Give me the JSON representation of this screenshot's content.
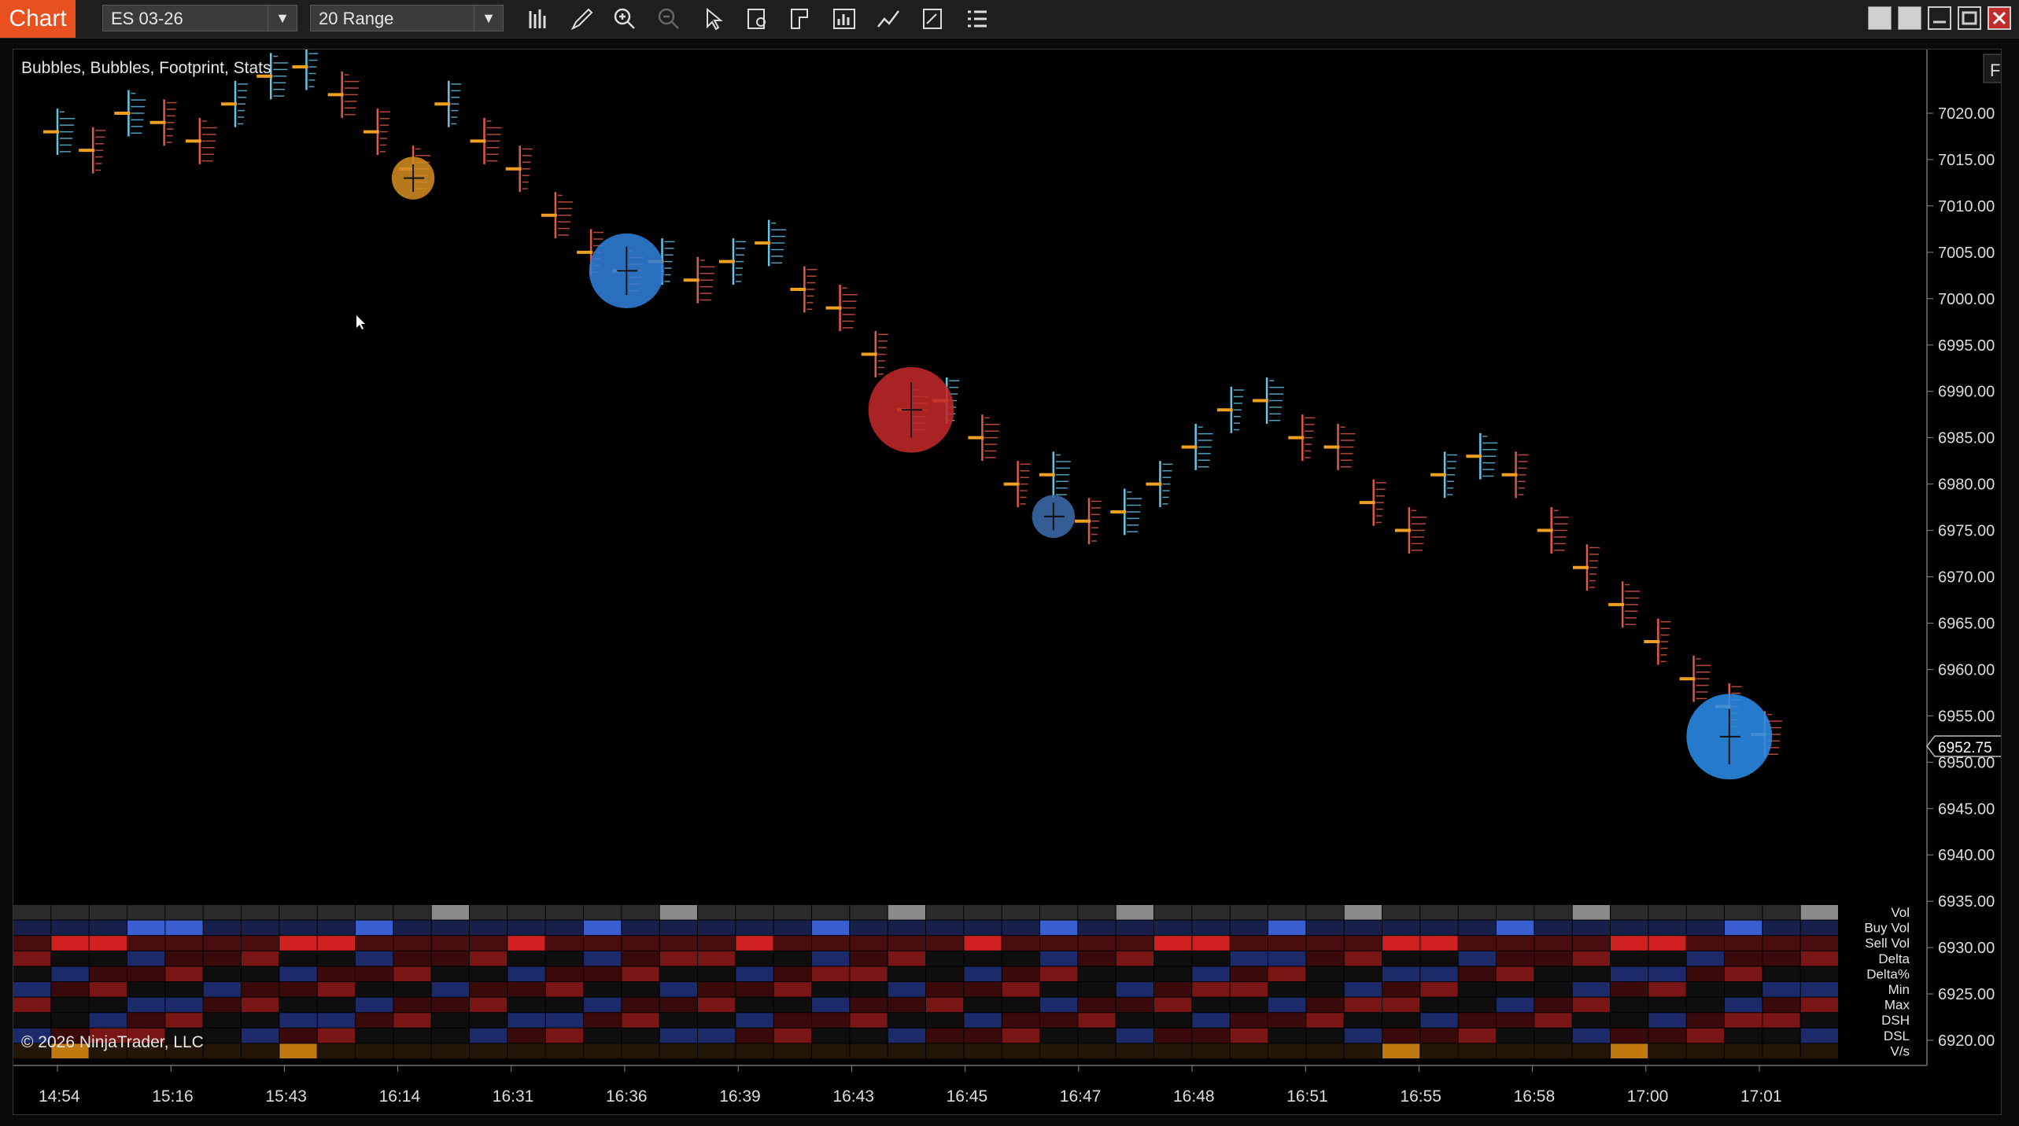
{
  "app": {
    "tab_label": "Chart"
  },
  "toolbar": {
    "instrument": "ES 03-26",
    "bar_type": "20 Range",
    "icons": [
      "bar-type-icon",
      "draw-pencil-icon",
      "zoom-in-icon",
      "zoom-out-icon",
      "pointer-icon",
      "data-box-icon",
      "templates-icon",
      "indicators-icon",
      "strategies-icon",
      "properties-icon",
      "list-icon"
    ]
  },
  "chart": {
    "indicator_label": "Bubbles, Bubbles, Footprint, Stats",
    "f_button_label": "F",
    "copyright": "© 2026 NinjaTrader, LLC",
    "last_price": "6952.75",
    "price_axis_labels": [
      "7020.00",
      "7015.00",
      "7010.00",
      "7005.00",
      "7000.00",
      "6995.00",
      "6990.00",
      "6985.00",
      "6980.00",
      "6975.00",
      "6970.00",
      "6965.00",
      "6960.00",
      "6955.00",
      "6950.00",
      "6945.00",
      "6940.00",
      "6935.00",
      "6930.00",
      "6925.00",
      "6920.00"
    ],
    "time_axis_labels": [
      "14:54",
      "15:16",
      "15:43",
      "16:14",
      "16:31",
      "16:36",
      "16:39",
      "16:43",
      "16:45",
      "16:47",
      "16:48",
      "16:51",
      "16:55",
      "16:58",
      "17:00",
      "17:01"
    ],
    "stats_rows": [
      "Vol",
      "Buy Vol",
      "Sell Vol",
      "Delta",
      "Delta%",
      "Min",
      "Max",
      "DSH",
      "DSL",
      "V/s"
    ],
    "bars_mid": [
      7018,
      7016,
      7020,
      7019,
      7017,
      7021,
      7024,
      7025,
      7022,
      7018,
      7014,
      7021,
      7017,
      7014,
      7009,
      7005,
      7003,
      7004,
      7002,
      7004,
      7006,
      7001,
      6999,
      6994,
      6988,
      6989,
      6985,
      6980,
      6981,
      6976,
      6977,
      6980,
      6984,
      6988,
      6989,
      6985,
      6984,
      6978,
      6975,
      6981,
      6983,
      6981,
      6975,
      6971,
      6967,
      6963,
      6959,
      6956,
      6953
    ],
    "bubbles": [
      {
        "bar": 10,
        "price": 7013,
        "color": "#d08a20",
        "size": 0.8
      },
      {
        "bar": 16,
        "price": 7003,
        "color": "#2f7ed8",
        "size": 1.4
      },
      {
        "bar": 24,
        "price": 6988,
        "color": "#c0282a",
        "size": 1.6
      },
      {
        "bar": 28,
        "price": 6976.5,
        "color": "#3a6aa8",
        "size": 0.8
      },
      {
        "bar": 47,
        "price": 6952.75,
        "color": "#2a8be8",
        "size": 1.6
      }
    ],
    "colors": {
      "bull": "#63c8e8",
      "bear": "#e05a4a",
      "poc": "#f0a020",
      "buy": "#3a5fd0",
      "sell": "#d02020"
    }
  }
}
